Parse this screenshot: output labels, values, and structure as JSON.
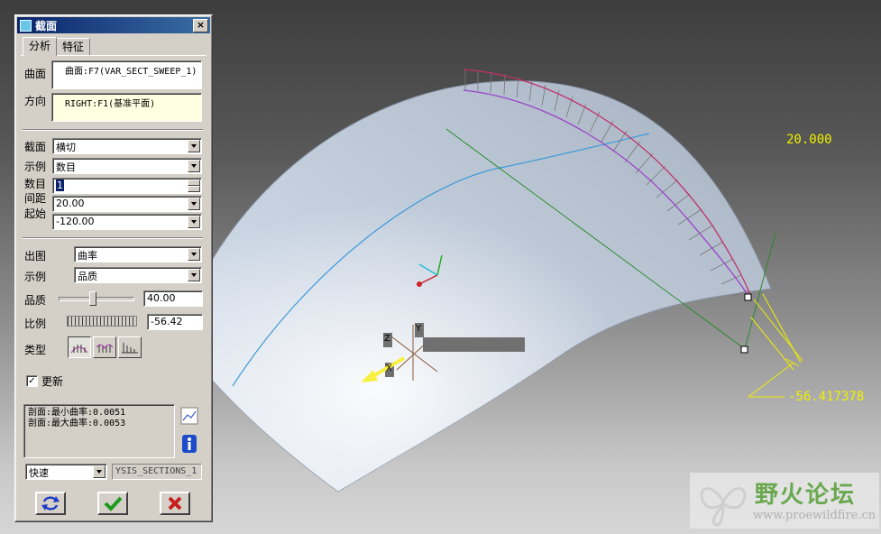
{
  "dialog": {
    "title": "截面",
    "tabs": [
      "分析",
      "特征"
    ],
    "surface_label": "曲面",
    "surface_value": "曲面:F7(VAR_SECT_SWEEP_1)",
    "direction_label": "方向",
    "direction_value": "RIGHT:F1(基准平面)",
    "section_label": "截面",
    "section_value": "横切",
    "example_label": "示例",
    "example_value": "数目",
    "count_label": "数目",
    "count_value": "1",
    "spacing_label": "间距",
    "spacing_value": "20.00",
    "start_label": "起始",
    "start_value": "-120.00",
    "plot_label": "出图",
    "plot_value": "曲率",
    "example2_label": "示例",
    "example2_value": "品质",
    "quality_label": "品质",
    "quality_value": "40.00",
    "quality_fraction": 0.45,
    "scale_label": "比例",
    "scale_value": "-56.42",
    "type_label": "类型",
    "update_label": "更新",
    "update_checked": true,
    "result_line1": "剖面:最小曲率:0.0051",
    "result_line2": "剖面:最大曲率:0.0053",
    "mode_value": "快速",
    "analysis_name": "YSIS_SECTIONS_1",
    "colors": {
      "title_bar": "#0a246a",
      "ok": "#1f9a1f",
      "cancel": "#c81e1e",
      "repeat": "#1e3cc8"
    }
  },
  "viewport": {
    "dim_top": "20.000",
    "dim_bottom": "-56.417378",
    "csys_axes": [
      "Z",
      "Y",
      "X"
    ],
    "label_color": "#f0f000"
  },
  "watermark": {
    "name": "野火论坛",
    "url": "www.proewildfire.cn"
  }
}
